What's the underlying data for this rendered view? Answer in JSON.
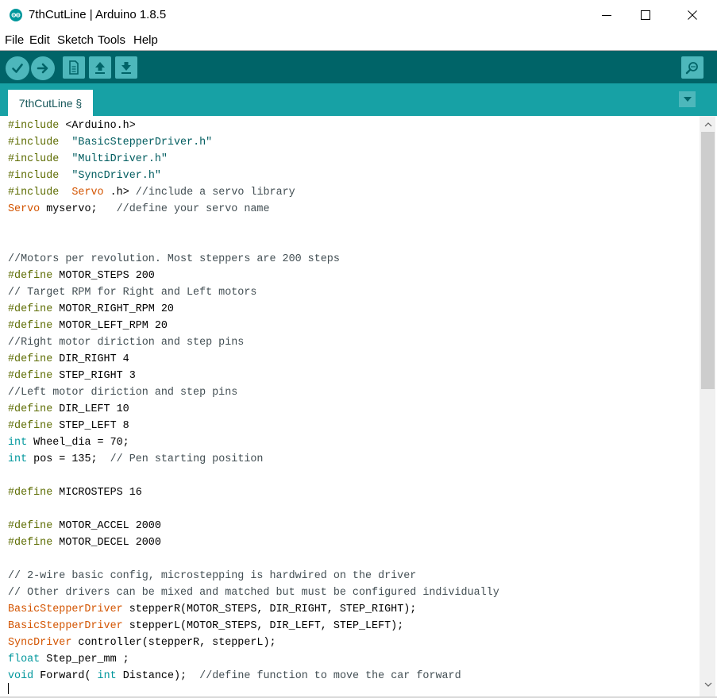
{
  "window": {
    "title": "7thCutLine | Arduino 1.8.5",
    "icon": "arduino-logo-icon",
    "controls": [
      "minimize-icon",
      "maximize-icon",
      "close-icon"
    ]
  },
  "menu": {
    "items": [
      "File",
      "Edit",
      "Sketch",
      "Tools",
      "Help"
    ]
  },
  "toolbar": {
    "buttons": [
      "verify-icon",
      "upload-icon",
      "new-icon",
      "open-icon",
      "save-icon",
      "serial-monitor-icon"
    ]
  },
  "tabs": [
    {
      "label": "7thCutLine §"
    }
  ],
  "code": {
    "lines": [
      [
        [
          "kw",
          "#include"
        ],
        [
          "",
          "<Arduino.h>"
        ]
      ],
      [
        [
          "kw",
          "#include"
        ],
        [
          "",
          ""
        ],
        [
          "st",
          "\"BasicStepperDriver.h\""
        ]
      ],
      [
        [
          "kw",
          "#include"
        ],
        [
          "",
          ""
        ],
        [
          "st",
          "\"MultiDriver.h\""
        ]
      ],
      [
        [
          "kw",
          "#include"
        ],
        [
          "",
          ""
        ],
        [
          "st",
          "\"SyncDriver.h\""
        ]
      ],
      [
        [
          "kw",
          "#include"
        ],
        [
          "",
          ""
        ],
        [
          "ty",
          "Servo"
        ],
        [
          "",
          ".h>"
        ],
        [
          "cm",
          "//include a servo library"
        ]
      ],
      [
        [
          "ty",
          "Servo"
        ],
        [
          "",
          "myservo;  "
        ],
        [
          "cm",
          "//define your servo name"
        ]
      ],
      [],
      [],
      [
        [
          "cm",
          "//Motors per revolution. Most steppers are 200 steps"
        ]
      ],
      [
        [
          "kw",
          "#define"
        ],
        [
          "",
          "MOTOR_STEPS 200"
        ]
      ],
      [
        [
          "cm",
          "// Target RPM for Right and Left motors"
        ]
      ],
      [
        [
          "kw",
          "#define"
        ],
        [
          "",
          "MOTOR_RIGHT_RPM 20"
        ]
      ],
      [
        [
          "kw",
          "#define"
        ],
        [
          "",
          "MOTOR_LEFT_RPM 20"
        ]
      ],
      [
        [
          "cm",
          "//Right motor diriction and step pins"
        ]
      ],
      [
        [
          "kw",
          "#define"
        ],
        [
          "",
          "DIR_RIGHT 4"
        ]
      ],
      [
        [
          "kw",
          "#define"
        ],
        [
          "",
          "STEP_RIGHT 3"
        ]
      ],
      [
        [
          "cm",
          "//Left motor diriction and step pins"
        ]
      ],
      [
        [
          "kw",
          "#define"
        ],
        [
          "",
          "DIR_LEFT 10"
        ]
      ],
      [
        [
          "kw",
          "#define"
        ],
        [
          "",
          "STEP_LEFT 8"
        ]
      ],
      [
        [
          "dt",
          "int"
        ],
        [
          "",
          "Wheel_dia = 70;"
        ]
      ],
      [
        [
          "dt",
          "int"
        ],
        [
          "",
          "pos = 135; "
        ],
        [
          "cm",
          "// Pen starting position"
        ]
      ],
      [],
      [
        [
          "kw",
          "#define"
        ],
        [
          "",
          "MICROSTEPS 16"
        ]
      ],
      [],
      [
        [
          "kw",
          "#define"
        ],
        [
          "",
          "MOTOR_ACCEL 2000"
        ]
      ],
      [
        [
          "kw",
          "#define"
        ],
        [
          "",
          "MOTOR_DECEL 2000"
        ]
      ],
      [],
      [
        [
          "cm",
          "// 2-wire basic config, microstepping is hardwired on the driver"
        ]
      ],
      [
        [
          "cm",
          "// Other drivers can be mixed and matched but must be configured individually"
        ]
      ],
      [
        [
          "ty",
          "BasicStepperDriver"
        ],
        [
          "",
          "stepperR(MOTOR_STEPS, DIR_RIGHT, STEP_RIGHT);"
        ]
      ],
      [
        [
          "ty",
          "BasicStepperDriver"
        ],
        [
          "",
          "stepperL(MOTOR_STEPS, DIR_LEFT, STEP_LEFT);"
        ]
      ],
      [
        [
          "ty",
          "SyncDriver"
        ],
        [
          "",
          "controller(stepperR, stepperL);"
        ]
      ],
      [
        [
          "dt",
          "float"
        ],
        [
          "",
          "Step_per_mm ;"
        ]
      ],
      [
        [
          "dt",
          "void"
        ],
        [
          "",
          "Forward("
        ],
        [
          "dt",
          "int"
        ],
        [
          "",
          "Distance); "
        ],
        [
          "cm",
          "//define function to move the car forward"
        ]
      ]
    ]
  },
  "colors": {
    "toolbar_bg": "#006468",
    "tabbar_bg": "#17a1a5",
    "button_bg": "#4db7bb",
    "keyword": "#5e6d03",
    "type": "#d35400",
    "datatype": "#00979c",
    "comment": "#434f54",
    "string": "#005c5f"
  }
}
